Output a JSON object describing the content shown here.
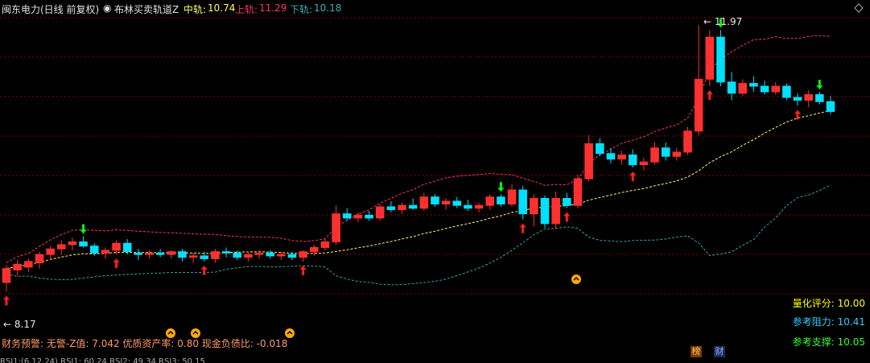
{
  "header": {
    "stock": "闽东电力(日线 前复权)",
    "indicator": "布林买卖轨道Z",
    "mid_label": "中轨:",
    "mid_value": "10.74",
    "upper_label": "上轨:",
    "upper_value": "11.29",
    "lower_label": "下轨:",
    "lower_value": "10.18"
  },
  "annotations": {
    "high_label": "← 11.97",
    "low_label": "← 8.17"
  },
  "finance_line": "财务预警: 无警-Z值: 7.042 优质资产率: 0.80 现金负债比: -0.018",
  "side_panel": {
    "score_label": "量化评分:",
    "score_value": "10.00",
    "resistance_label": "参考阻力:",
    "resistance_value": "10.41",
    "support_label": "参考支撑:",
    "support_value": "10.05"
  },
  "badges": {
    "bang": "榜",
    "cai": "财"
  },
  "bottom_text": "RSI1:(6,12,24) RSI1: 60.24 RSI2: 49.34 RSI3: 50.15",
  "colors": {
    "up": "#ff3030",
    "down": "#00e0ff",
    "upper_band": "#ff3366",
    "mid_band": "#ffff66",
    "lower_band": "#3aa0a0",
    "grid": "#8b0000",
    "arrow_up": "#ff2020",
    "arrow_down": "#00ff00"
  },
  "chart_data": {
    "type": "candlestick",
    "note_range": [
      8.17,
      11.97
    ],
    "candles": [
      [
        8.3,
        8.55,
        8.17,
        8.5
      ],
      [
        8.48,
        8.62,
        8.4,
        8.56
      ],
      [
        8.52,
        8.64,
        8.45,
        8.6
      ],
      [
        8.58,
        8.74,
        8.5,
        8.7
      ],
      [
        8.7,
        8.82,
        8.62,
        8.78
      ],
      [
        8.78,
        8.9,
        8.7,
        8.84
      ],
      [
        8.84,
        8.94,
        8.76,
        8.88
      ],
      [
        8.88,
        8.96,
        8.8,
        8.82
      ],
      [
        8.82,
        8.86,
        8.68,
        8.72
      ],
      [
        8.72,
        8.8,
        8.64,
        8.76
      ],
      [
        8.76,
        8.9,
        8.7,
        8.86
      ],
      [
        8.86,
        8.92,
        8.7,
        8.74
      ],
      [
        8.72,
        8.78,
        8.62,
        8.7
      ],
      [
        8.7,
        8.76,
        8.64,
        8.72
      ],
      [
        8.72,
        8.78,
        8.66,
        8.7
      ],
      [
        8.7,
        8.76,
        8.64,
        8.74
      ],
      [
        8.74,
        8.78,
        8.6,
        8.66
      ],
      [
        8.66,
        8.72,
        8.58,
        8.68
      ],
      [
        8.68,
        8.74,
        8.6,
        8.64
      ],
      [
        8.64,
        8.78,
        8.58,
        8.74
      ],
      [
        8.74,
        8.8,
        8.66,
        8.72
      ],
      [
        8.72,
        8.76,
        8.62,
        8.66
      ],
      [
        8.66,
        8.74,
        8.6,
        8.7
      ],
      [
        8.7,
        8.76,
        8.64,
        8.72
      ],
      [
        8.72,
        8.76,
        8.64,
        8.68
      ],
      [
        8.68,
        8.74,
        8.62,
        8.7
      ],
      [
        8.7,
        8.74,
        8.62,
        8.66
      ],
      [
        8.66,
        8.76,
        8.6,
        8.74
      ],
      [
        8.74,
        8.84,
        8.68,
        8.8
      ],
      [
        8.8,
        8.92,
        8.76,
        8.88
      ],
      [
        8.88,
        9.4,
        8.84,
        9.28
      ],
      [
        9.28,
        9.36,
        9.18,
        9.22
      ],
      [
        9.22,
        9.3,
        9.16,
        9.26
      ],
      [
        9.26,
        9.32,
        9.18,
        9.22
      ],
      [
        9.22,
        9.42,
        9.18,
        9.38
      ],
      [
        9.38,
        9.46,
        9.3,
        9.34
      ],
      [
        9.34,
        9.44,
        9.28,
        9.4
      ],
      [
        9.4,
        9.5,
        9.34,
        9.36
      ],
      [
        9.36,
        9.58,
        9.32,
        9.52
      ],
      [
        9.52,
        9.56,
        9.38,
        9.42
      ],
      [
        9.42,
        9.5,
        9.34,
        9.46
      ],
      [
        9.46,
        9.52,
        9.36,
        9.4
      ],
      [
        9.4,
        9.48,
        9.32,
        9.36
      ],
      [
        9.36,
        9.44,
        9.3,
        9.4
      ],
      [
        9.4,
        9.56,
        9.34,
        9.52
      ],
      [
        9.52,
        9.56,
        9.38,
        9.42
      ],
      [
        9.42,
        9.7,
        9.38,
        9.62
      ],
      [
        9.62,
        9.68,
        9.2,
        9.28
      ],
      [
        9.28,
        9.56,
        9.1,
        9.5
      ],
      [
        9.5,
        9.54,
        9.08,
        9.14
      ],
      [
        9.14,
        9.6,
        9.06,
        9.5
      ],
      [
        9.5,
        9.58,
        9.36,
        9.4
      ],
      [
        9.4,
        9.84,
        9.36,
        9.78
      ],
      [
        9.78,
        10.4,
        9.74,
        10.28
      ],
      [
        10.28,
        10.36,
        10.1,
        10.14
      ],
      [
        10.14,
        10.22,
        10.0,
        10.06
      ],
      [
        10.06,
        10.18,
        9.98,
        10.12
      ],
      [
        10.12,
        10.2,
        9.94,
        9.98
      ],
      [
        9.98,
        10.08,
        9.9,
        10.02
      ],
      [
        10.02,
        10.3,
        9.98,
        10.22
      ],
      [
        10.22,
        10.3,
        10.04,
        10.1
      ],
      [
        10.1,
        10.22,
        10.04,
        10.16
      ],
      [
        10.16,
        10.52,
        10.12,
        10.46
      ],
      [
        10.46,
        11.97,
        10.4,
        11.2
      ],
      [
        11.2,
        11.9,
        11.1,
        11.8
      ],
      [
        11.8,
        11.9,
        11.1,
        11.16
      ],
      [
        11.16,
        11.3,
        10.9,
        11.0
      ],
      [
        11.0,
        11.2,
        10.96,
        11.14
      ],
      [
        11.14,
        11.24,
        11.02,
        11.1
      ],
      [
        11.1,
        11.18,
        10.98,
        11.02
      ],
      [
        11.02,
        11.16,
        10.98,
        11.1
      ],
      [
        11.1,
        11.14,
        10.9,
        10.94
      ],
      [
        10.94,
        11.0,
        10.82,
        10.9
      ],
      [
        10.9,
        11.04,
        10.8,
        10.98
      ],
      [
        10.98,
        11.02,
        10.84,
        10.88
      ],
      [
        10.88,
        10.96,
        10.7,
        10.74
      ]
    ]
  }
}
